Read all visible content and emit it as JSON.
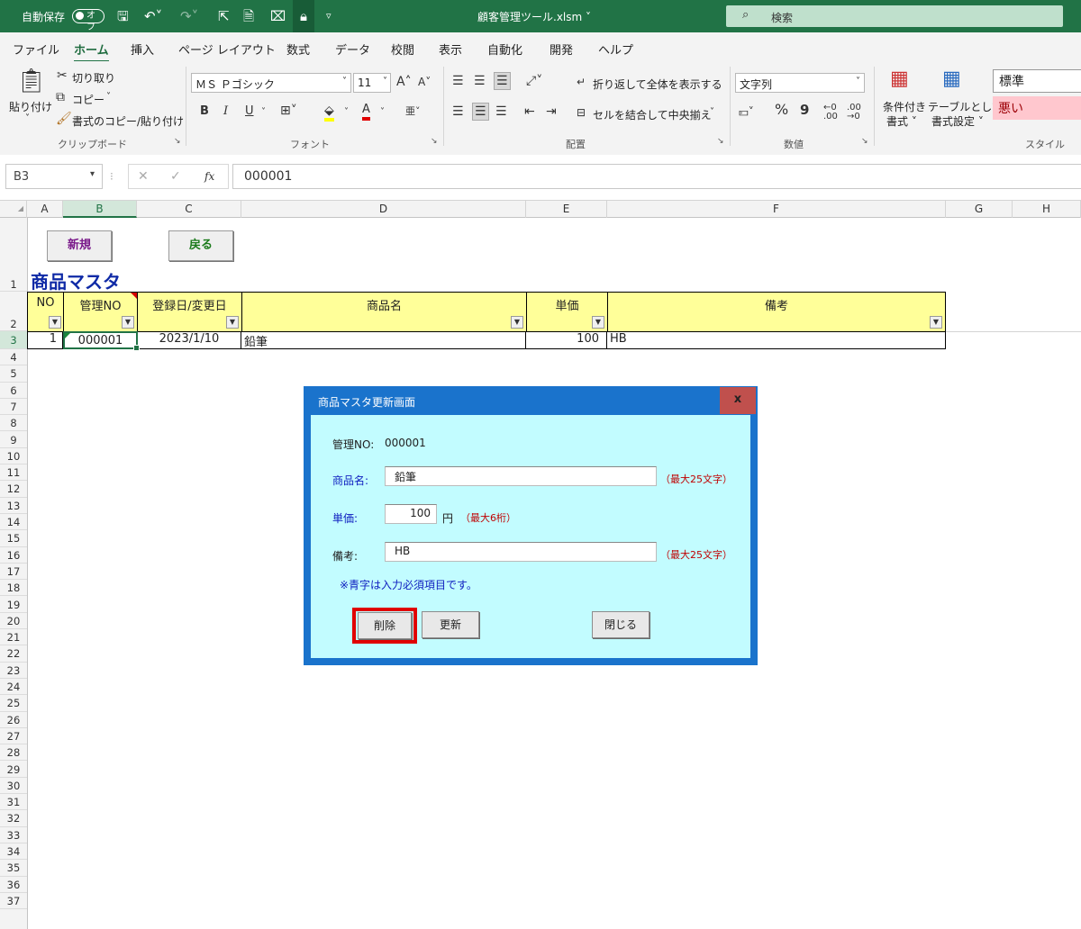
{
  "titlebar": {
    "autosave_label": "自動保存",
    "autosave_state": "オフ",
    "filename": "顧客管理ツール.xlsm",
    "search_placeholder": "検索"
  },
  "menu": [
    "ファイル",
    "ホーム",
    "挿入",
    "ページ レイアウト",
    "数式",
    "データ",
    "校閲",
    "表示",
    "自動化",
    "開発",
    "ヘルプ"
  ],
  "ribbon": {
    "clipboard": {
      "paste": "貼り付け",
      "cut": "切り取り",
      "copy": "コピー",
      "format_painter": "書式のコピー/貼り付け",
      "group": "クリップボード"
    },
    "font": {
      "name": "ＭＳ Ｐゴシック",
      "size": "11",
      "group": "フォント",
      "bold": "B",
      "italic": "I",
      "underline": "U"
    },
    "alignment": {
      "wrap": "折り返して全体を表示する",
      "merge": "セルを結合して中央揃え",
      "group": "配置"
    },
    "number": {
      "format": "文字列",
      "percent": "%",
      "comma": "9",
      "group": "数値"
    },
    "styles": {
      "cond": "条件付き",
      "cond2": "書式",
      "table": "テーブルとして",
      "table2": "書式設定",
      "normal": "標準",
      "bad": "悪い",
      "group": "スタイル"
    }
  },
  "formula": {
    "namebox": "B3",
    "value": "000001",
    "fx": "fx"
  },
  "columns": [
    "A",
    "B",
    "C",
    "D",
    "E",
    "F",
    "G",
    "H"
  ],
  "rows": [
    "1",
    "2",
    "3",
    "4",
    "5",
    "6",
    "7",
    "8",
    "9",
    "10",
    "11",
    "12",
    "13",
    "14",
    "15",
    "16",
    "17",
    "18",
    "19",
    "20",
    "21",
    "22",
    "23",
    "24",
    "25",
    "26",
    "27",
    "28",
    "29",
    "30",
    "31",
    "32",
    "33",
    "34",
    "35",
    "36",
    "37"
  ],
  "sheet": {
    "btn_new": "新規",
    "btn_back": "戻る",
    "title": "商品マスタ",
    "headers": [
      "NO",
      "管理NO",
      "登録日/変更日",
      "商品名",
      "単価",
      "備考"
    ],
    "row": [
      "1",
      "000001",
      "2023/1/10",
      "鉛筆",
      "100",
      "HB"
    ]
  },
  "dialog": {
    "title": "商品マスタ更新画面",
    "close": "x",
    "mgmt_label": "管理NO:",
    "mgmt_value": "000001",
    "name_label": "商品名:",
    "name_value": "鉛筆",
    "name_hint": "（最大25文字）",
    "price_label": "単価:",
    "price_value": "100",
    "price_unit": "円",
    "price_hint": "（最大6桁）",
    "note_label": "備考:",
    "note_value": "HB",
    "note_hint": "（最大25文字）",
    "required_note": "※青字は入力必須項目です。",
    "btn_delete": "削除",
    "btn_update": "更新",
    "btn_close": "閉じる"
  }
}
